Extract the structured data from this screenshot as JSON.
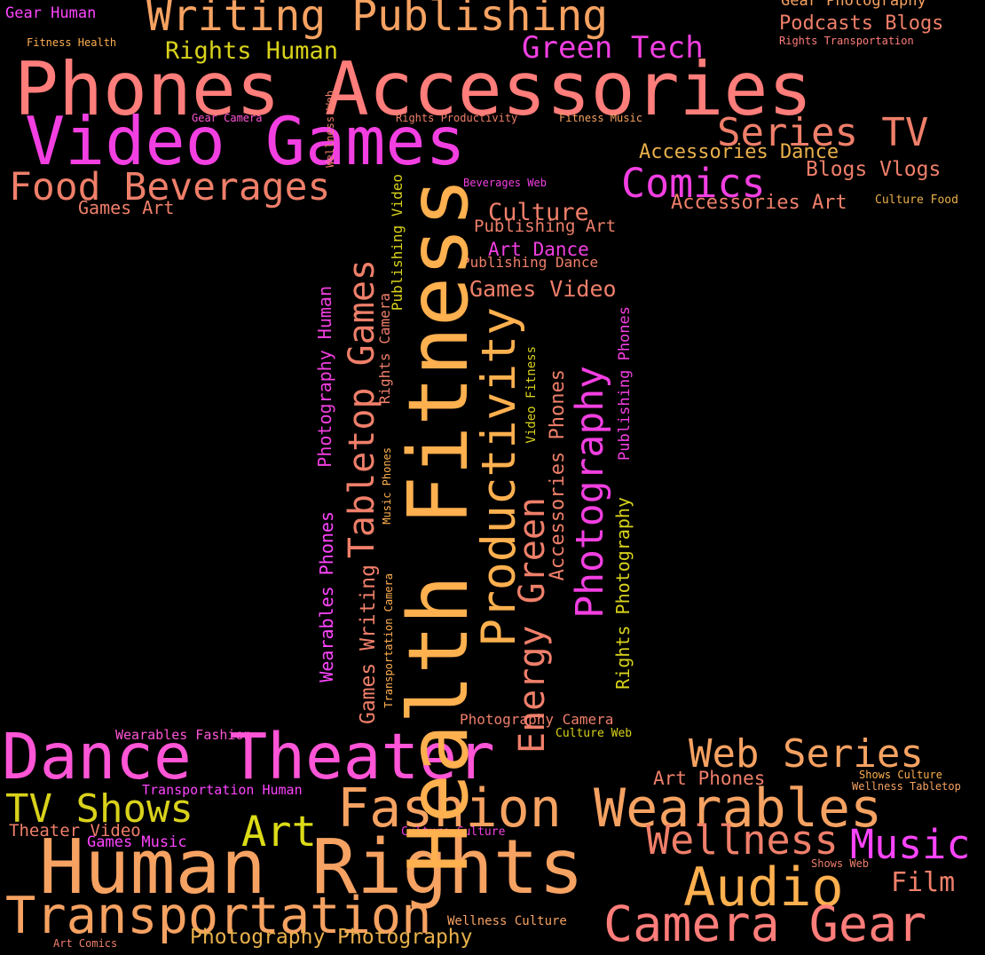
{
  "colors": {
    "background": "#000000",
    "palette": [
      "#ff45ff",
      "#ff55d6",
      "#f23fe1",
      "#ff7d7a",
      "#ef7f6a",
      "#f6a262",
      "#ffb04f",
      "#e9b04b",
      "#d9d21b",
      "#dcdc18"
    ]
  },
  "words": [
    "Gear Human",
    "Writing Publishing",
    "Gear Photography",
    "Podcasts Blogs",
    "Fitness Health",
    "Rights Human",
    "Green Tech",
    "Rights Transportation",
    "Phones Accessories",
    "Gear Camera",
    "Wellness Web",
    "Rights Productivity",
    "Fitness Music",
    "Video Games",
    "Series TV",
    "Accessories Dance",
    "Blogs Vlogs",
    "Food Beverages",
    "Comics",
    "Beverages Web",
    "Games Art",
    "Accessories Art",
    "Culture Food",
    "Publishing Video",
    "Health Fitness",
    "Culture",
    "Publishing Art",
    "Art Dance",
    "Publishing Dance",
    "Rights Camera",
    "Games Video",
    "Tabletop Games",
    "Photography Human",
    "Productivity",
    "Video Fitness",
    "Photography",
    "Publishing Phones",
    "Accessories Phones",
    "Energy Green",
    "Music Phones",
    "Wearables Phones",
    "Games Writing",
    "Transportation Camera",
    "Rights Photography",
    "Photography Camera",
    "Culture Web",
    "Wearables Fashion",
    "Dance Theater",
    "Web Series",
    "Art Phones",
    "Shows Culture",
    "Wellness Tabletop",
    "Transportation Human",
    "TV Shows",
    "Fashion Wearables",
    "Art",
    "Theater Video",
    "Games Music",
    "Culture Culture",
    "Wellness",
    "Music",
    "Human Rights",
    "Shows Web",
    "Audio",
    "Film",
    "Transportation",
    "Wellness Culture",
    "Camera Gear",
    "Photography Photography",
    "Art Comics"
  ]
}
